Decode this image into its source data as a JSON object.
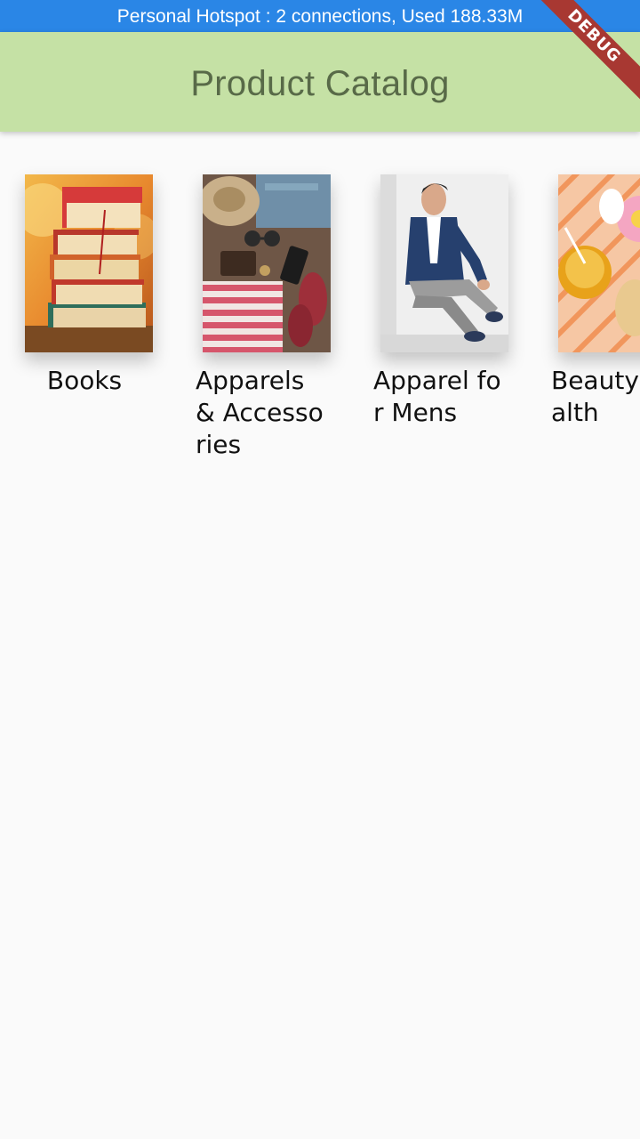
{
  "status_bar": {
    "text": "Personal Hotspot : 2 connections, Used 188.33M"
  },
  "app_bar": {
    "title": "Product Catalog",
    "background": "#c5e1a5",
    "title_color": "#586a48"
  },
  "debug_banner": {
    "label": "DEBUG",
    "color": "#a83832"
  },
  "categories": [
    {
      "label": "Books",
      "image": "books-image"
    },
    {
      "label": "Apparels & Accessories",
      "image": "apparels-accessories-image"
    },
    {
      "label": "Apparel for Mens",
      "image": "mens-apparel-image"
    },
    {
      "label": "Beauty Health",
      "image": "beauty-health-image"
    }
  ]
}
